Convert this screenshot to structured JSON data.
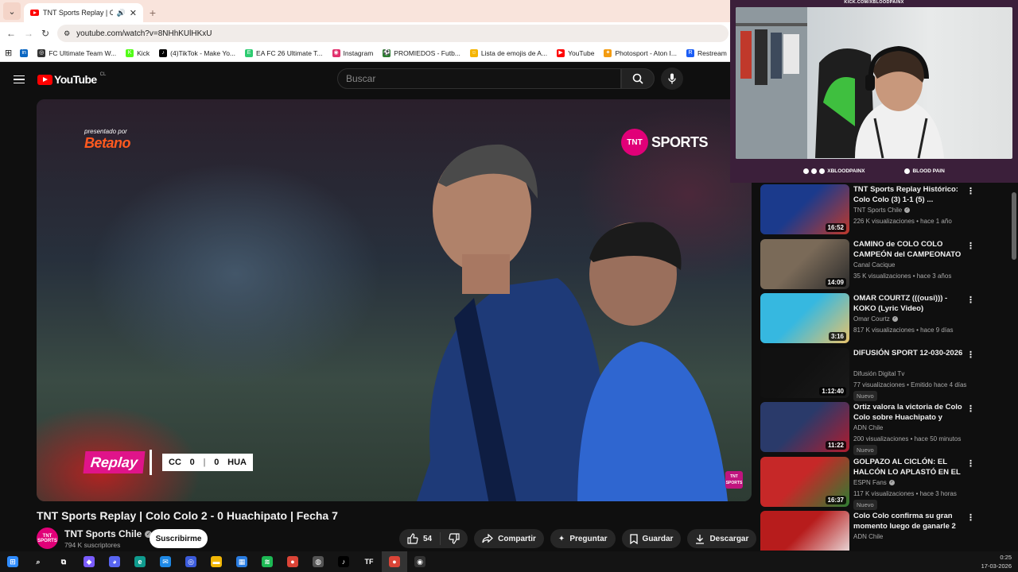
{
  "browser": {
    "tab_title": "TNT Sports Replay | Colo C",
    "url": "youtube.com/watch?v=8NHhKUlHKxU",
    "bookmarks": [
      {
        "label": "",
        "color": "#0a66c2",
        "glyph": "in"
      },
      {
        "label": "FC Ultimate Team W...",
        "color": "#333333",
        "glyph": "◎"
      },
      {
        "label": "Kick",
        "color": "#53fc18",
        "glyph": "K"
      },
      {
        "label": "(4)TikTok - Make Yo...",
        "color": "#000000",
        "glyph": "♪"
      },
      {
        "label": "EA FC 26 Ultimate T...",
        "color": "#2ecc71",
        "glyph": "E"
      },
      {
        "label": "Instagram",
        "color": "#e1306c",
        "glyph": "◉"
      },
      {
        "label": "PROMIEDOS - Futb...",
        "color": "#2e7d32",
        "glyph": "⚽"
      },
      {
        "label": "Lista de emojis de A...",
        "color": "#f5b400",
        "glyph": "☺"
      },
      {
        "label": "YouTube",
        "color": "#ff0000",
        "glyph": "▶"
      },
      {
        "label": "Photosport - Aton I...",
        "color": "#f39c12",
        "glyph": "✦"
      },
      {
        "label": "Restream",
        "color": "#1b5df5",
        "glyph": "R"
      },
      {
        "label": "Res",
        "color": "#111111",
        "glyph": "▪"
      }
    ]
  },
  "youtube": {
    "region": "CL",
    "search_placeholder": "Buscar",
    "logo_text": "YouTube"
  },
  "video": {
    "sponsor_small": "presentado por",
    "sponsor": "Betano",
    "network": "TNT",
    "network_word": "SPORTS",
    "replay_label": "Replay",
    "score": {
      "home": "CC",
      "home_goals": "0",
      "away_goals": "0",
      "away": "HUA"
    },
    "corner_badge": "TNT SPORTS",
    "title": "TNT Sports Replay | Colo Colo 2 - 0 Huachipato | Fecha 7"
  },
  "channel": {
    "avatar_text": "TNT SPORTS",
    "name": "TNT Sports Chile",
    "subs": "794 K suscriptores",
    "subscribe_label": "Suscribirme"
  },
  "actions": {
    "likes": "54",
    "share": "Compartir",
    "ask": "Preguntar",
    "save": "Guardar",
    "download": "Descargar"
  },
  "stream_overlay": {
    "kick_url": "KICK.COM/XBLOODPAINX",
    "handle_left": "XBLOODPAINX",
    "handle_right": "BLOOD PAIN"
  },
  "recommendations": [
    {
      "title": "TNT Sports Replay Histórico: Colo Colo (3) 1-1 (5) ...",
      "channel": "TNT Sports Chile",
      "verified": true,
      "meta": "226 K visualizaciones • hace 1 año",
      "duration": "16:52",
      "badge": "",
      "thumb": [
        "#1b3a8c",
        "#c0392b"
      ]
    },
    {
      "title": "CAMINO de COLO COLO CAMPEÓN del CAMPEONATO ...",
      "channel": "Canal Cacique",
      "verified": false,
      "meta": "35 K visualizaciones • hace 3 años",
      "duration": "14:09",
      "badge": "",
      "thumb": [
        "#7a6a58",
        "#2b2b2b"
      ]
    },
    {
      "title": "OMAR COURTZ (((ousi))) - KOKO (Lyric Video)",
      "channel": "Omar Courtz",
      "verified": true,
      "meta": "817 K visualizaciones • hace 9 días",
      "duration": "3:16",
      "badge": "",
      "thumb": [
        "#36b8e0",
        "#e8c36a"
      ]
    },
    {
      "title": "DIFUSIÓN SPORT 12-030-2026",
      "channel": "Difusión Digital Tv",
      "verified": false,
      "meta": "77 visualizaciones • Emitido hace 4 días",
      "duration": "1:12:40",
      "badge": "Nuevo",
      "thumb": [
        "#111111",
        "#1a1a1a"
      ]
    },
    {
      "title": "Ortiz valora la victoria de Colo Colo sobre Huachipato y abor...",
      "channel": "ADN Chile",
      "verified": false,
      "meta": "200 visualizaciones • hace 50 minutos",
      "duration": "11:22",
      "badge": "Nuevo",
      "thumb": [
        "#2a3a6a",
        "#b01c2e"
      ]
    },
    {
      "title": "GOLPAZO AL CICLÓN: EL HALCÓN LO APLASTÓ EN EL ...",
      "channel": "ESPN Fans",
      "verified": true,
      "meta": "117 K visualizaciones • hace 3 horas",
      "duration": "16:37",
      "badge": "Nuevo",
      "thumb": [
        "#c62828",
        "#2e7d32"
      ]
    },
    {
      "title": "Colo Colo confirma su gran momento luego de ganarle 2 a...",
      "channel": "ADN Chile",
      "verified": false,
      "meta": "",
      "duration": "",
      "badge": "",
      "thumb": [
        "#b71c1c",
        "#eeeeee"
      ]
    }
  ],
  "taskbar": {
    "time": "0:25",
    "date": "17-03-2026",
    "apps": [
      {
        "name": "windows",
        "color": "#2f8cff",
        "glyph": "⊞"
      },
      {
        "name": "search",
        "color": "#141414",
        "glyph": "⌕"
      },
      {
        "name": "task-view",
        "color": "#141414",
        "glyph": "⧉"
      },
      {
        "name": "copilot",
        "color": "#7a5cff",
        "glyph": "◆"
      },
      {
        "name": "discord",
        "color": "#5865f2",
        "glyph": "◕"
      },
      {
        "name": "edge",
        "color": "#0f9b8e",
        "glyph": "e"
      },
      {
        "name": "mail",
        "color": "#1e88e5",
        "glyph": "✉"
      },
      {
        "name": "ring",
        "color": "#3b5bdb",
        "glyph": "◎"
      },
      {
        "name": "explorer",
        "color": "#f2b705",
        "glyph": "▬"
      },
      {
        "name": "store",
        "color": "#2a7de1",
        "glyph": "▦"
      },
      {
        "name": "spotify",
        "color": "#1db954",
        "glyph": "≋"
      },
      {
        "name": "chrome",
        "color": "#db4437",
        "glyph": "●"
      },
      {
        "name": "game",
        "color": "#555555",
        "glyph": "◍"
      },
      {
        "name": "tiktok",
        "color": "#000000",
        "glyph": "♪"
      },
      {
        "name": "tf",
        "color": "#141414",
        "glyph": "TF"
      },
      {
        "name": "chrome-active",
        "color": "#db4437",
        "glyph": "●"
      },
      {
        "name": "obs",
        "color": "#333333",
        "glyph": "◉"
      }
    ]
  }
}
